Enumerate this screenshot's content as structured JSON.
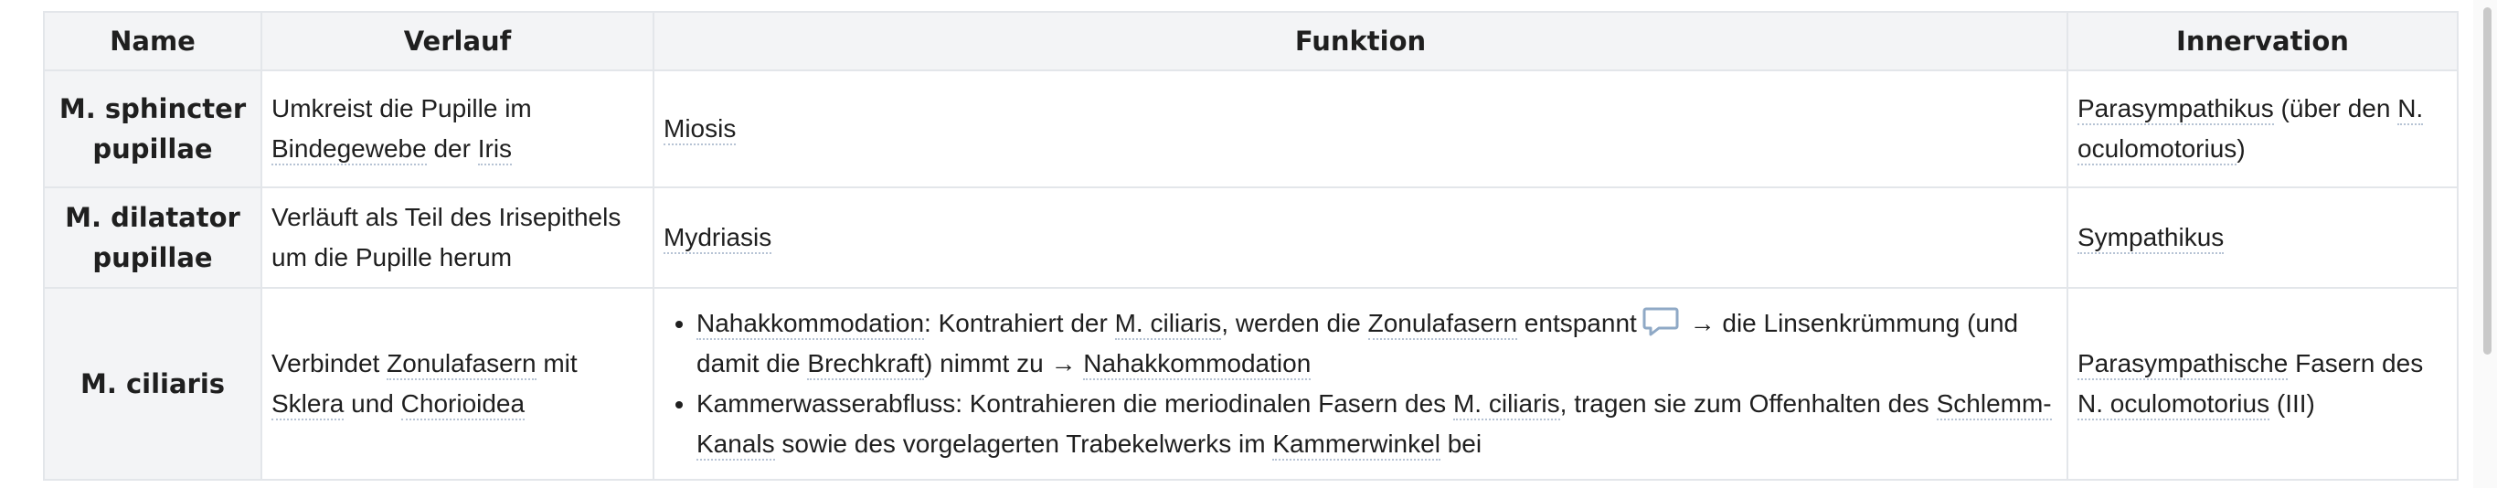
{
  "table": {
    "headers": {
      "name": "Name",
      "verlauf": "Verlauf",
      "funktion": "Funktion",
      "innervation": "Innervation"
    },
    "rows": [
      {
        "name": "M. sphincter pupillae",
        "verlauf": {
          "t1": "Umkreist die Pupille im ",
          "l1": "Bindegewebe",
          "t2": " der ",
          "l2": "Iris"
        },
        "funktion": {
          "l1": "Miosis"
        },
        "innervation": {
          "l1": "Parasympathikus",
          "t1": " (über den ",
          "l2": "N. oculomotorius",
          "t2": ")"
        }
      },
      {
        "name": "M. dilatator pupillae",
        "verlauf": {
          "t1": "Verläuft als Teil des Irisepithels um die Pupille herum"
        },
        "funktion": {
          "l1": "Mydriasis"
        },
        "innervation": {
          "l1": "Sympathikus"
        }
      },
      {
        "name": "M. ciliaris",
        "verlauf": {
          "t1": "Verbindet ",
          "l1": "Zonulafasern",
          "t2": " mit ",
          "l2": "Sklera",
          "t3": " und ",
          "l3": "Chorioidea"
        },
        "funktion": {
          "item1": {
            "l1": "Nahakkommodation",
            "t1": ": Kontrahiert der ",
            "l2": "M. ciliaris",
            "t2": ", werden die ",
            "l3": "Zonulafasern",
            "t3": " entspannt",
            "t4": " → die Linsenkrümmung (und damit die ",
            "l4": "Brechkraft",
            "t5": ") nimmt zu → ",
            "l5": "Nahakkommodation"
          },
          "item2": {
            "t1": "Kammerwasserabfluss: Kontrahieren die meriodinalen Fasern des ",
            "l1": "M. ciliaris",
            "t2": ", tragen sie zum Offenhalten des ",
            "l2": "Schlemm-Kanals",
            "t3": " sowie des vorgelagerten Trabekelwerks im ",
            "l3": "Kammerwinkel",
            "t4": " bei"
          }
        },
        "innervation": {
          "l1": "Parasympathische",
          "t1": " Fasern des ",
          "l2": "N. oculomotorius",
          "t2": " (III)"
        }
      }
    ]
  },
  "icons": {
    "comment": "comment-icon"
  },
  "colors": {
    "link_underline": "#b6c3d4",
    "header_bg": "#f3f4f6",
    "border": "#e3e6ea",
    "icon": "#8fa9c6"
  }
}
